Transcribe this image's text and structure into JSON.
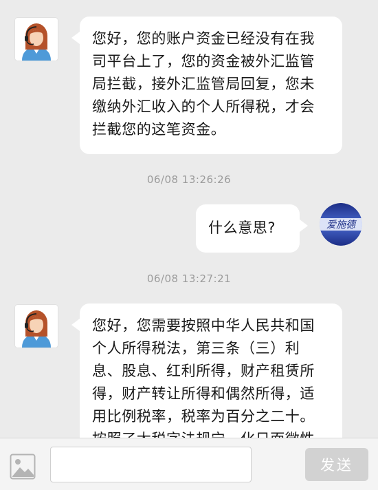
{
  "messages": [
    {
      "lines": [
        "您好，您的账户资金已经没有在我",
        "司平台上了，您的资金被外汇监管",
        "局拦截，接外汇监管局回复，您未",
        "缴纳外汇收入的个人所得税，才会",
        "拦截您的这笔资金。"
      ]
    },
    {
      "time": "06/08 13:26:26"
    },
    {
      "text": "什么意思?"
    },
    {
      "time": "06/08 13:27:21"
    },
    {
      "lines": [
        "您好，您需要按照中华人民共和国",
        "个人所得税法，第三条（三）利",
        "息、股息、红利所得，财产租赁所",
        "得，财产转让所得和偶然所得，适",
        "用比例税率，税率为百分之二十。",
        "按照了太税字法规宁，化日面微性"
      ]
    }
  ],
  "user_avatar": {
    "text": "爱施德"
  },
  "composer": {
    "input_value": "",
    "send_label": "发送"
  },
  "colors": {
    "background": "#ebebeb",
    "bubble": "#ffffff",
    "send_disabled": "#d2d2d2",
    "avatar_blue": "#2a3f9e"
  },
  "icons": {
    "agent_avatar": "customer-service-agent-avatar",
    "image_button": "image-icon"
  }
}
